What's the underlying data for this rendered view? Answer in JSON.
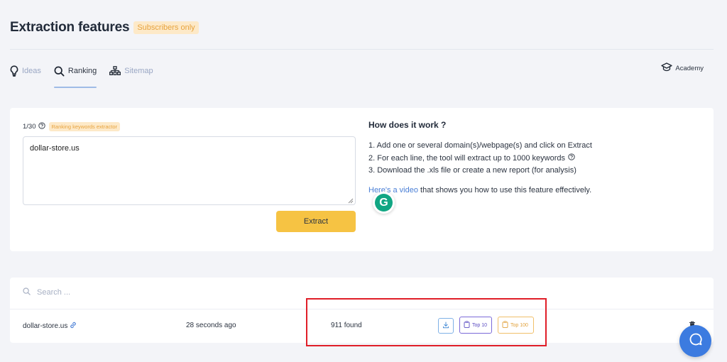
{
  "header": {
    "title": "Extraction features",
    "badge": "Subscribers only"
  },
  "tabs": [
    {
      "label": "Ideas",
      "icon": "lightbulb-icon",
      "active": false
    },
    {
      "label": "Ranking",
      "icon": "search-icon",
      "active": true
    },
    {
      "label": "Sitemap",
      "icon": "sitemap-icon",
      "active": false
    }
  ],
  "academy": {
    "label": "Academy",
    "icon": "graduation-cap-icon"
  },
  "extractor": {
    "counter": "1/30",
    "chip": "Ranking keywords extractor",
    "textarea_value": "dollar-store.us",
    "extract_label": "Extract"
  },
  "how": {
    "title": "How does it work ?",
    "steps": [
      "1. Add one or several domain(s)/webpage(s) and click on Extract",
      "2. For each line, the tool will extract up to 1000 keywords",
      "3. Download the .xls file or create a new report (for analysis)"
    ],
    "video_link": "Here's a video",
    "video_rest": " that shows you how to use this feature effectively."
  },
  "results": {
    "search_placeholder": "Search ...",
    "rows": [
      {
        "domain": "dollar-store.us",
        "ago": "28 seconds ago",
        "found": "911 found",
        "top10": "Top 10",
        "top100": "Top 100"
      }
    ]
  },
  "colors": {
    "accent": "#f6c343",
    "link": "#4a7fd6",
    "highlight": "#e01e28",
    "chat": "#3c7be0"
  }
}
